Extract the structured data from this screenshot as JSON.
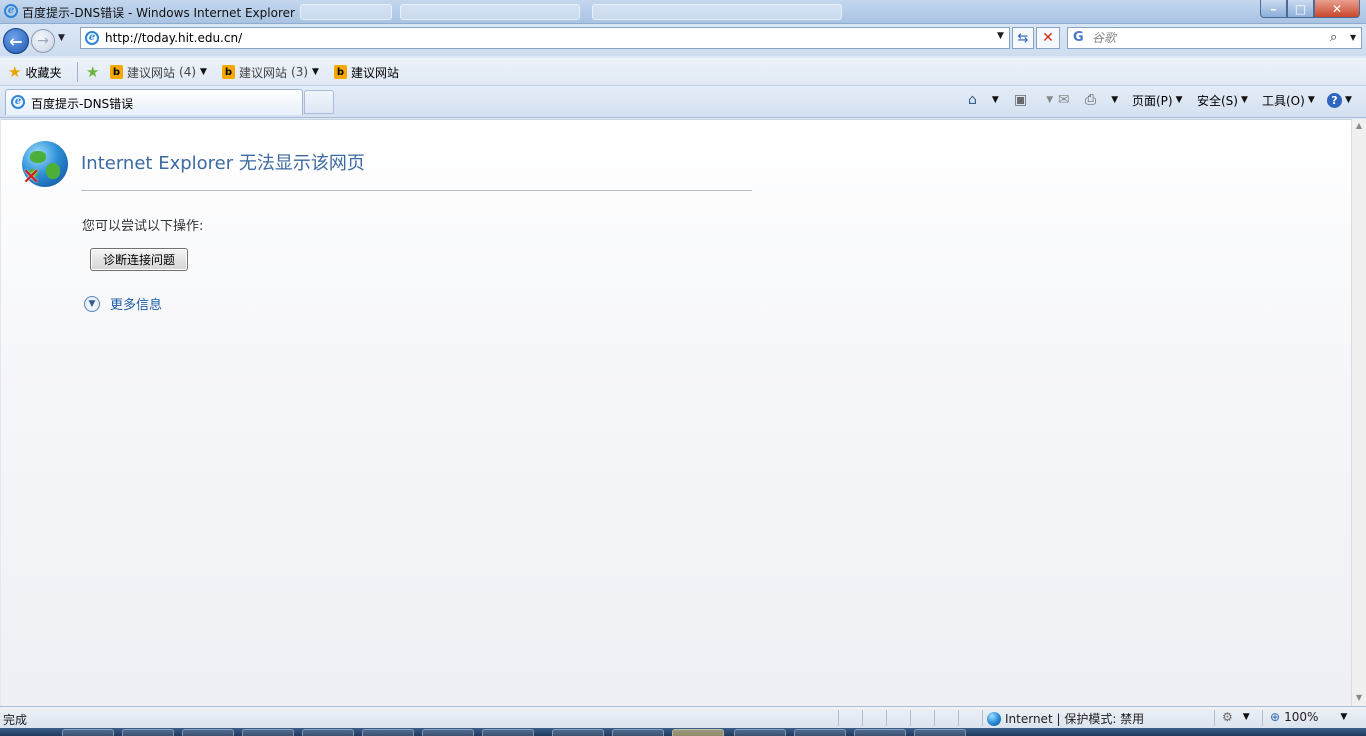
{
  "window": {
    "title": "百度提示-DNS错误 - Windows Internet Explorer"
  },
  "navigation": {
    "address": "http://today.hit.edu.cn/",
    "search_placeholder": "谷歌"
  },
  "favorites_bar": {
    "favorites_label": "收藏夹",
    "items": [
      {
        "label": "建议网站",
        "count": "(4)"
      },
      {
        "label": "建议网站",
        "count": "(3)"
      },
      {
        "label": "建议网站",
        "count": ""
      }
    ]
  },
  "tab": {
    "label": "百度提示-DNS错误"
  },
  "command_bar": {
    "page_label": "页面(P)",
    "safety_label": "安全(S)",
    "tools_label": "工具(O)"
  },
  "content": {
    "error_title": "Internet Explorer 无法显示该网页",
    "intro": "您可以尝试以下操作:",
    "diagnose_button": "诊断连接问题",
    "more_info": "更多信息"
  },
  "status_bar": {
    "status": "完成",
    "zone": "Internet | 保护模式: 禁用",
    "zoom": "100%"
  }
}
